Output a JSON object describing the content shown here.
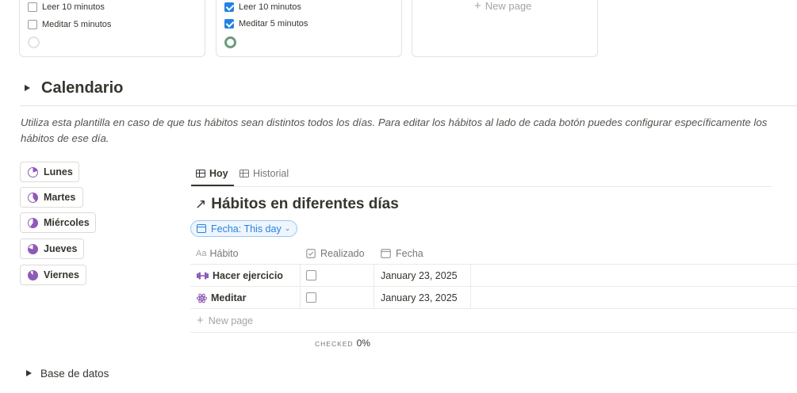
{
  "cards": [
    {
      "items": [
        {
          "label": "Leer 10 minutos",
          "checked": false
        },
        {
          "label": "Meditar 5 minutos",
          "checked": false
        }
      ],
      "progress": "empty"
    },
    {
      "items": [
        {
          "label": "Leer 10 minutos",
          "checked": true
        },
        {
          "label": "Meditar 5 minutos",
          "checked": true
        }
      ],
      "progress": "complete"
    },
    {
      "new_page": "New page"
    }
  ],
  "section": {
    "title": "Calendario",
    "description": "Utiliza esta plantilla en caso de que tus hábitos sean distintos todos los días. Para editar los hábitos al lado de cada botón puedes configurar específicamente los hábitos de ese día."
  },
  "days": [
    {
      "label": "Lunes",
      "fill": 0.2
    },
    {
      "label": "Martes",
      "fill": 0.4
    },
    {
      "label": "Miércoles",
      "fill": 0.6
    },
    {
      "label": "Jueves",
      "fill": 0.8
    },
    {
      "label": "Viernes",
      "fill": 0.9
    }
  ],
  "tabs": [
    {
      "label": "Hoy",
      "active": true
    },
    {
      "label": "Historial",
      "active": false
    }
  ],
  "database": {
    "title": "Hábitos en diferentes días",
    "filter": "Fecha: This day",
    "columns": {
      "habit": "Hábito",
      "habit_prefix": "Aa",
      "done": "Realizado",
      "date": "Fecha"
    },
    "rows": [
      {
        "icon": "dumbbell-icon",
        "name": "Hacer ejercicio",
        "done": false,
        "date": "January 23, 2025"
      },
      {
        "icon": "atom-icon",
        "name": "Meditar",
        "done": false,
        "date": "January 23, 2025"
      }
    ],
    "new_page": "New page",
    "summary": {
      "label": "CHECKED",
      "value": "0%"
    }
  },
  "footer_toggle": "Base de datos",
  "colors": {
    "accent": "#2383e2",
    "purple": "#8e5ab8",
    "green": "#6c9b7d"
  }
}
